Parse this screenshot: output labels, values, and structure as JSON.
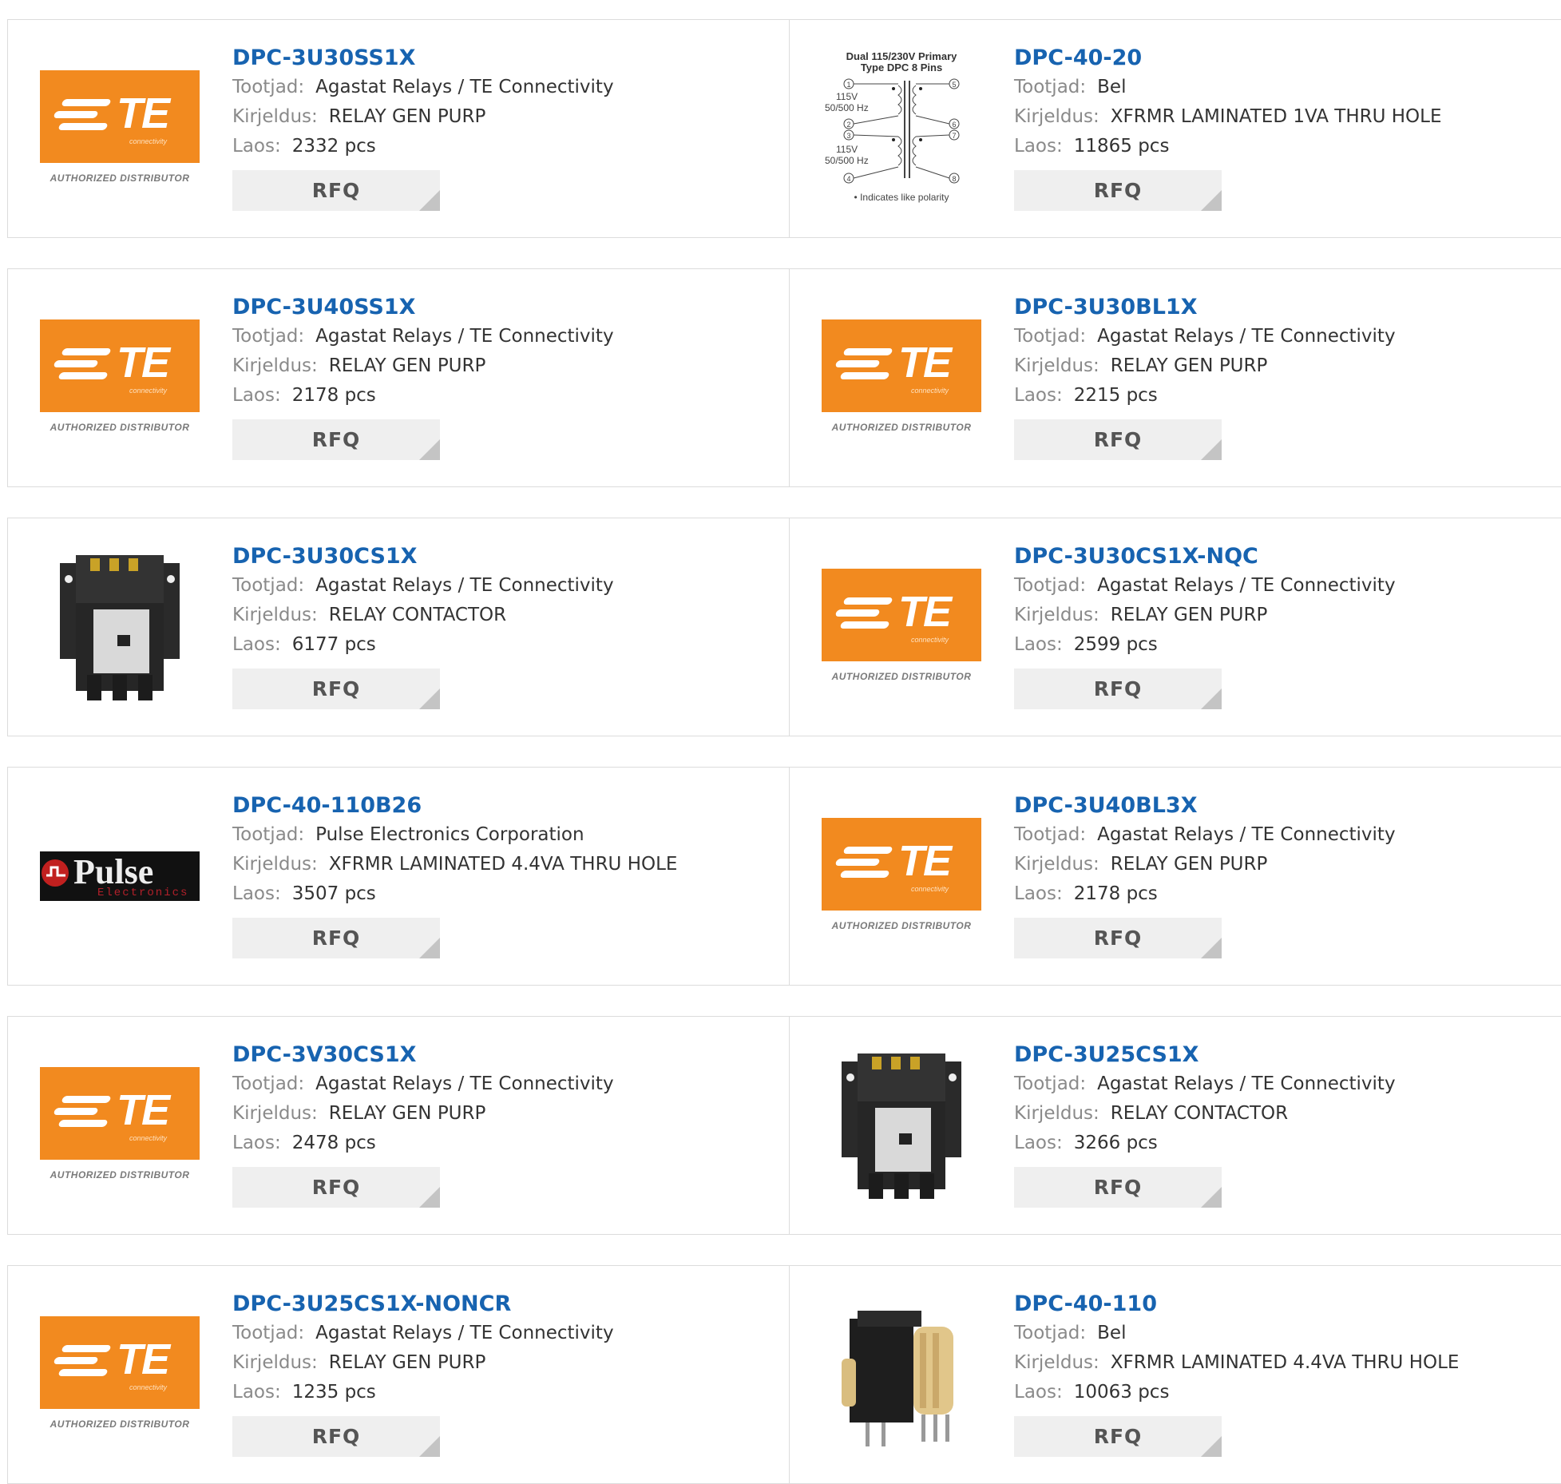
{
  "labels": {
    "manufacturer": "Tootjad:",
    "description": "Kirjeldus:",
    "stock": "Laos:",
    "rfq": "RFQ"
  },
  "te_logo": {
    "word": "TE",
    "sub": "connectivity",
    "authorized": "AUTHORIZED DISTRIBUTOR"
  },
  "pulse_logo": {
    "word": "Pulse",
    "sub": "Electronics"
  },
  "transformer_diagram": {
    "title1": "Dual 115/230V Primary",
    "title2": "Type DPC 8 Pins",
    "v1": "115V",
    "f1": "50/500 Hz",
    "v2": "115V",
    "f2": "50/500 Hz",
    "pins": [
      "1",
      "2",
      "3",
      "4",
      "5",
      "6",
      "7",
      "8"
    ],
    "note": "• Indicates like polarity"
  },
  "colors": {
    "link": "#1763b0",
    "te_orange": "#f28a1f",
    "button_bg": "#efefef"
  },
  "products": [
    {
      "pn": "DPC-3U30SS1X",
      "manufacturer": "Agastat Relays / TE Connectivity",
      "description": "RELAY GEN PURP",
      "stock": "2332 pcs",
      "image": "te-logo"
    },
    {
      "pn": "DPC-40-20",
      "manufacturer": "Bel",
      "description": "XFRMR LAMINATED 1VA THRU HOLE",
      "stock": "11865 pcs",
      "image": "transformer-diagram"
    },
    {
      "pn": "DPC-3U40SS1X",
      "manufacturer": "Agastat Relays / TE Connectivity",
      "description": "RELAY GEN PURP",
      "stock": "2178 pcs",
      "image": "te-logo"
    },
    {
      "pn": "DPC-3U30BL1X",
      "manufacturer": "Agastat Relays / TE Connectivity",
      "description": "RELAY GEN PURP",
      "stock": "2215 pcs",
      "image": "te-logo"
    },
    {
      "pn": "DPC-3U30CS1X",
      "manufacturer": "Agastat Relays / TE Connectivity",
      "description": "RELAY CONTACTOR",
      "stock": "6177 pcs",
      "image": "contactor-photo"
    },
    {
      "pn": "DPC-3U30CS1X-NQC",
      "manufacturer": "Agastat Relays / TE Connectivity",
      "description": "RELAY GEN PURP",
      "stock": "2599 pcs",
      "image": "te-logo"
    },
    {
      "pn": "DPC-40-110B26",
      "manufacturer": "Pulse Electronics Corporation",
      "description": "XFRMR LAMINATED 4.4VA THRU HOLE",
      "stock": "3507 pcs",
      "image": "pulse-logo"
    },
    {
      "pn": "DPC-3U40BL3X",
      "manufacturer": "Agastat Relays / TE Connectivity",
      "description": "RELAY GEN PURP",
      "stock": "2178 pcs",
      "image": "te-logo"
    },
    {
      "pn": "DPC-3V30CS1X",
      "manufacturer": "Agastat Relays / TE Connectivity",
      "description": "RELAY GEN PURP",
      "stock": "2478 pcs",
      "image": "te-logo"
    },
    {
      "pn": "DPC-3U25CS1X",
      "manufacturer": "Agastat Relays / TE Connectivity",
      "description": "RELAY CONTACTOR",
      "stock": "3266 pcs",
      "image": "contactor-photo"
    },
    {
      "pn": "DPC-3U25CS1X-NONCR",
      "manufacturer": "Agastat Relays / TE Connectivity",
      "description": "RELAY GEN PURP",
      "stock": "1235 pcs",
      "image": "te-logo"
    },
    {
      "pn": "DPC-40-110",
      "manufacturer": "Bel",
      "description": "XFRMR LAMINATED 4.4VA THRU HOLE",
      "stock": "10063 pcs",
      "image": "transformer-photo"
    }
  ]
}
